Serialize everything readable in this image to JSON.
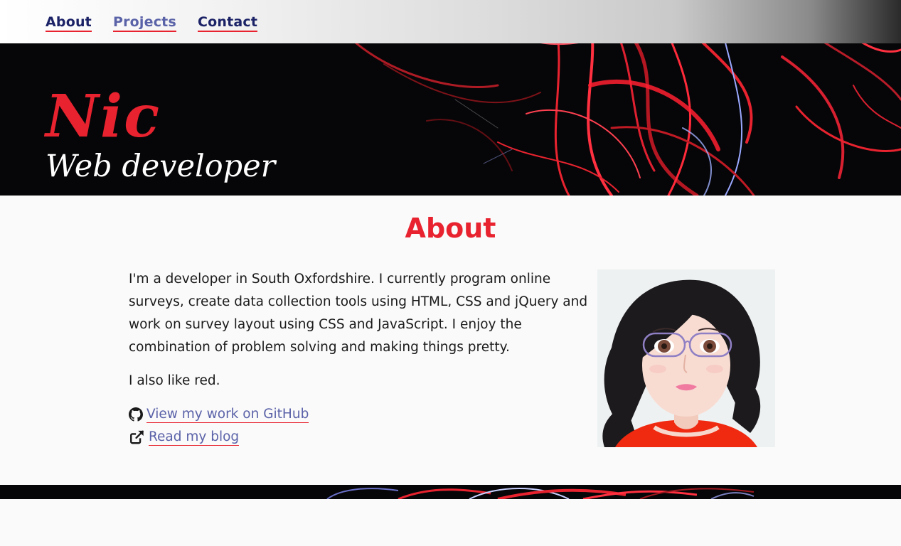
{
  "nav": {
    "items": [
      {
        "label": "About"
      },
      {
        "label": "Projects"
      },
      {
        "label": "Contact"
      }
    ]
  },
  "hero": {
    "name": "Nic",
    "role": "Web developer"
  },
  "about": {
    "heading": "About",
    "paragraphs": [
      "I'm a developer in South Oxfordshire. I currently program online surveys, create data collection tools using HTML, CSS and jQuery and work on survey layout using CSS and JavaScript. I enjoy the combination of problem solving and making things pretty.",
      "I also like red."
    ],
    "links": [
      {
        "label": "View my work on GitHub",
        "icon": "github-icon"
      },
      {
        "label": "Read my blog",
        "icon": "external-link-icon"
      }
    ]
  },
  "colors": {
    "accent": "#e8232f",
    "nav_text": "#1b2266",
    "link": "#5a62a8",
    "hero_bg": "#060608",
    "page_bg": "#fafafa"
  }
}
